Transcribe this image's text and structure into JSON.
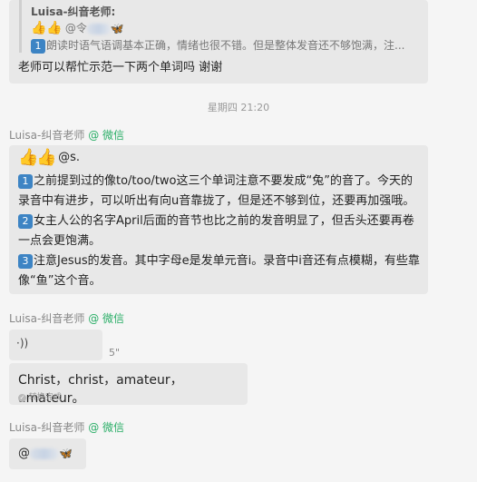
{
  "quoted": {
    "sender_label": "Luisa-纠音老师:",
    "line1_prefix": "@令",
    "line2_text": "朗读时语气语调基本正确，情绪也很不错。但是整体发音还不够饱满，注...",
    "line2_badge": "1"
  },
  "msg1": {
    "text": "老师可以帮忙示范一下两个单词吗 谢谢"
  },
  "divider": {
    "time": "星期四 21:20"
  },
  "sender_name": "Luisa-纠音老师",
  "sender_suffix": "@ 微信",
  "msg2": {
    "mention": "@s.",
    "items": [
      {
        "badge": "1",
        "text": "之前提到过的像to/too/two这三个单词注意不要发成“兔”的音了。今天的录音中有进步，可以听出有向u音靠拢了，但是还不够到位，还要再加强哦。"
      },
      {
        "badge": "2",
        "text": "女主人公的名字April后面的音节也比之前的发音明显了，但舌头还要再卷一点会更饱满。"
      },
      {
        "badge": "3",
        "text": "注意Jesus的发音。其中字母e是发单元音i。录音中i音还有点模糊，有些靠像“鱼”这个音。"
      }
    ]
  },
  "voice": {
    "duration": "5\"",
    "transcript": "Christ，christ，amateur，amateur。",
    "transcript_status": "转换完成"
  },
  "msg4": {
    "mention": "@"
  },
  "colors": {
    "accent_green": "#2aae67",
    "bubble": "#e8e8e8",
    "badge_blue": "#3d84c4"
  }
}
